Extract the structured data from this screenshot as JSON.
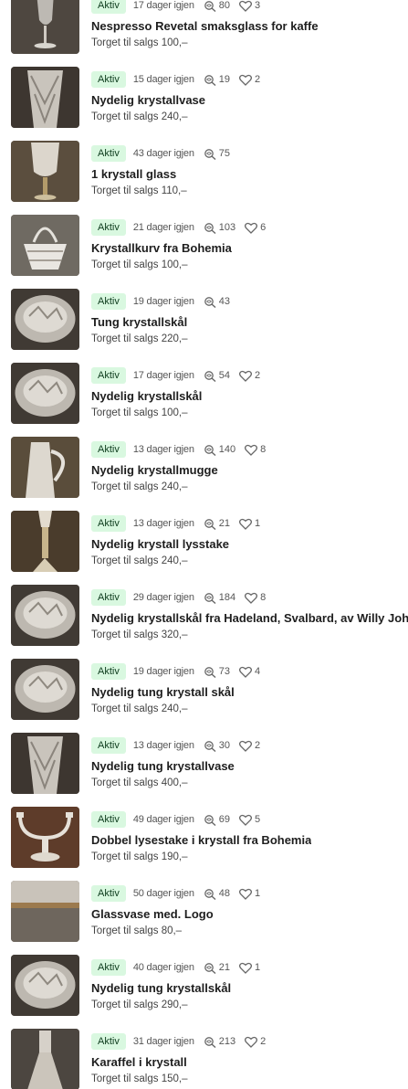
{
  "listings": [
    {
      "status": "Aktiv",
      "days": "17 dager igjen",
      "views": "80",
      "likes": "3",
      "title": "Nespresso Revetal smaksglass for kaffe",
      "price": "Torget til salgs 100,–",
      "thumb_icon": "wine-glass-photo"
    },
    {
      "status": "Aktiv",
      "days": "15 dager igjen",
      "views": "19",
      "likes": "2",
      "title": "Nydelig krystallvase",
      "price": "Torget til salgs 240,–",
      "thumb_icon": "crystal-vase-photo"
    },
    {
      "status": "Aktiv",
      "days": "43 dager igjen",
      "views": "75",
      "likes": "",
      "title": "1 krystall glass",
      "price": "Torget til salgs 110,–",
      "thumb_icon": "crystal-glass-photo"
    },
    {
      "status": "Aktiv",
      "days": "21 dager igjen",
      "views": "103",
      "likes": "6",
      "title": "Krystallkurv fra Bohemia",
      "price": "Torget til salgs 100,–",
      "thumb_icon": "crystal-basket-photo"
    },
    {
      "status": "Aktiv",
      "days": "19 dager igjen",
      "views": "43",
      "likes": "",
      "title": "Tung krystallskål",
      "price": "Torget til salgs 220,–",
      "thumb_icon": "crystal-bowl-photo"
    },
    {
      "status": "Aktiv",
      "days": "17 dager igjen",
      "views": "54",
      "likes": "2",
      "title": "Nydelig krystallskål",
      "price": "Torget til salgs 100,–",
      "thumb_icon": "crystal-bowl-photo"
    },
    {
      "status": "Aktiv",
      "days": "13 dager igjen",
      "views": "140",
      "likes": "8",
      "title": "Nydelig krystallmugge",
      "price": "Torget til salgs 240,–",
      "thumb_icon": "crystal-jug-photo"
    },
    {
      "status": "Aktiv",
      "days": "13 dager igjen",
      "views": "21",
      "likes": "1",
      "title": "Nydelig krystall lysstake",
      "price": "Torget til salgs 240,–",
      "thumb_icon": "candlestick-photo"
    },
    {
      "status": "Aktiv",
      "days": "29 dager igjen",
      "views": "184",
      "likes": "8",
      "title": "Nydelig krystallskål fra Hadeland, Svalbard, av Willy Johan",
      "price": "Torget til salgs 320,–",
      "thumb_icon": "crystal-bowl-photo"
    },
    {
      "status": "Aktiv",
      "days": "19 dager igjen",
      "views": "73",
      "likes": "4",
      "title": "Nydelig tung krystall skål",
      "price": "Torget til salgs 240,–",
      "thumb_icon": "crystal-bowl-photo"
    },
    {
      "status": "Aktiv",
      "days": "13 dager igjen",
      "views": "30",
      "likes": "2",
      "title": "Nydelig tung krystallvase",
      "price": "Torget til salgs 400,–",
      "thumb_icon": "crystal-vase-photo"
    },
    {
      "status": "Aktiv",
      "days": "49 dager igjen",
      "views": "69",
      "likes": "5",
      "title": "Dobbel lysestake i krystall fra Bohemia",
      "price": "Torget til salgs 190,–",
      "thumb_icon": "double-candlestick-photo"
    },
    {
      "status": "Aktiv",
      "days": "50 dager igjen",
      "views": "48",
      "likes": "1",
      "title": "Glassvase med. Logo",
      "price": "Torget til salgs 80,–",
      "thumb_icon": "glass-vase-photo"
    },
    {
      "status": "Aktiv",
      "days": "40 dager igjen",
      "views": "21",
      "likes": "1",
      "title": "Nydelig tung krystallskål",
      "price": "Torget til salgs 290,–",
      "thumb_icon": "crystal-bowl-photo"
    },
    {
      "status": "Aktiv",
      "days": "31 dager igjen",
      "views": "213",
      "likes": "2",
      "title": "Karaffel i krystall",
      "price": "Torget til salgs 150,–",
      "thumb_icon": "carafe-photo"
    }
  ],
  "colors": {
    "badge_bg": "#d9f8e0",
    "badge_text": "#0c3b1c",
    "title": "#1e1e1e",
    "meta": "#555555"
  }
}
